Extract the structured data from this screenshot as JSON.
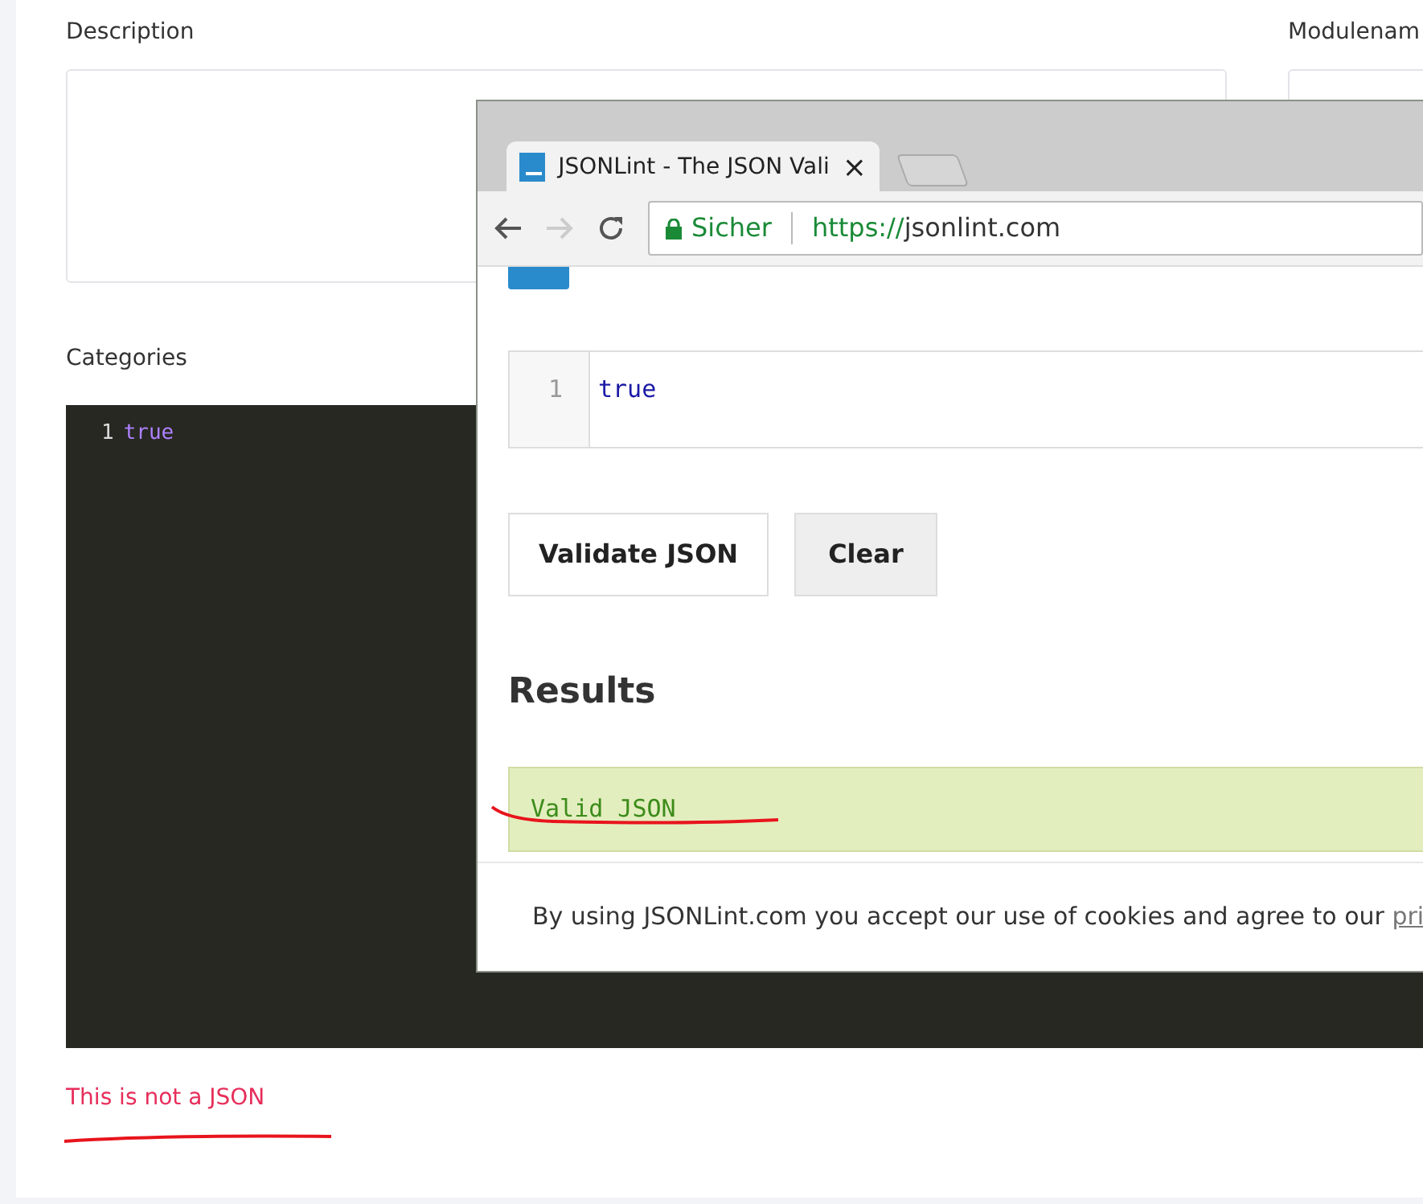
{
  "form": {
    "description_label": "Description",
    "modulename_label": "Modulenam",
    "categories_label": "Categories",
    "editor": {
      "lines": [
        {
          "number": "1",
          "text": "true"
        }
      ]
    },
    "error": "This is not a JSON"
  },
  "browser": {
    "tabs": [
      {
        "title": "JSONLint - The JSON Vali",
        "close": "×",
        "selected": true
      }
    ],
    "security": "Sicher",
    "url_scheme": "https://",
    "url_host": "jsonlint.com",
    "code": {
      "lines": [
        {
          "number": "1",
          "text": "true"
        }
      ]
    },
    "buttons": [
      "Validate JSON",
      "Clear"
    ],
    "results_title": "Results",
    "result": "Valid JSON",
    "cookie_text": "By using JSONLint.com you accept our use of cookies and agree to our",
    "cookie_link": "pri"
  }
}
